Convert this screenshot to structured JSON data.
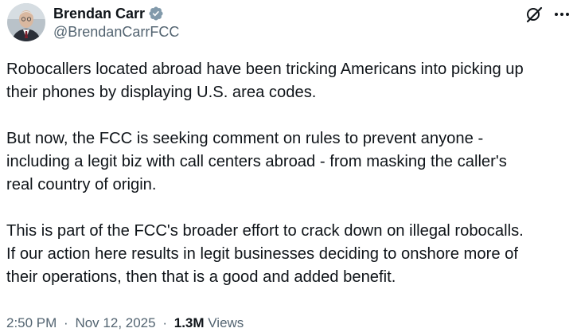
{
  "author": {
    "display_name": "Brendan Carr",
    "handle": "@BrendanCarrFCC",
    "verified": true,
    "verified_color": "#829aab"
  },
  "actions": {
    "grok_icon": "grok-icon",
    "more_icon": "more-icon"
  },
  "tweet": {
    "paragraphs": [
      {
        "lines": [
          "Robocallers located abroad have been tricking Americans into picking up",
          "their phones by displaying U.S. area codes."
        ]
      },
      {
        "lines": [
          "But now, the FCC is seeking comment on rules to prevent anyone -",
          "including a legit biz with call centers abroad - from masking the caller's",
          "real country of origin."
        ]
      },
      {
        "lines": [
          "This is part of the FCC's broader effort to crack down on illegal robocalls.",
          "If our action here results in legit businesses deciding to onshore more of",
          "their operations, then that is a good and added benefit."
        ]
      }
    ]
  },
  "meta": {
    "time": "2:50 PM",
    "separator": "·",
    "date": "Nov 12, 2025",
    "views_count": "1.3M",
    "views_label": "Views"
  },
  "colors": {
    "text_primary": "#0f1419",
    "text_secondary": "#536471",
    "background": "#ffffff"
  }
}
